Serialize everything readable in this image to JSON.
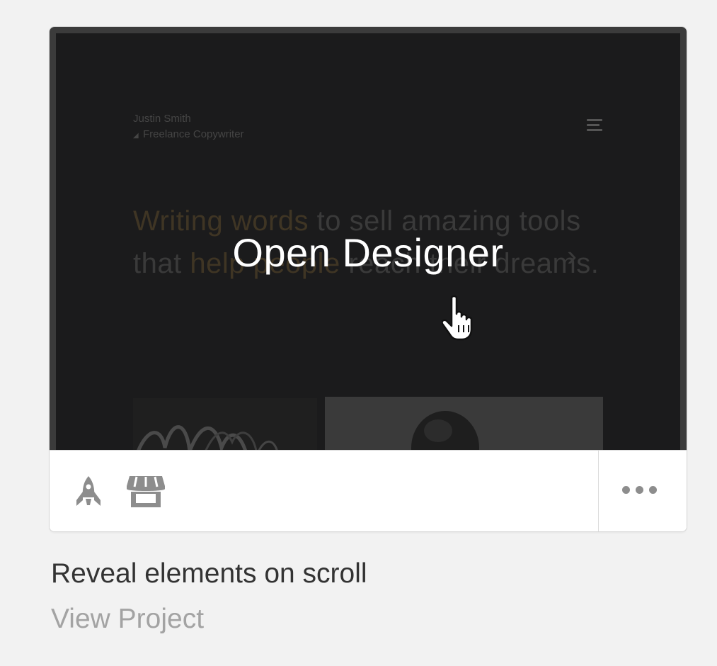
{
  "preview": {
    "brand_name": "Justin Smith",
    "brand_role": "Freelance Copywriter",
    "hero_highlight_1": "Writing words",
    "hero_text_1": " to sell amazing tools that ",
    "hero_highlight_2": "help people",
    "hero_text_2": " reach their dreams.",
    "overlay_label": "Open Designer"
  },
  "toolbar": {
    "publish_icon": "rocket-icon",
    "marketplace_icon": "storefront-icon",
    "more_icon": "more-dots-icon"
  },
  "project": {
    "title": "Reveal elements on scroll",
    "link_label": "View Project"
  },
  "colors": {
    "background": "#f2f2f2",
    "preview_bg": "#1b1b1c",
    "accent_text": "#3f3524",
    "icon_gray": "#8d8d8d"
  }
}
